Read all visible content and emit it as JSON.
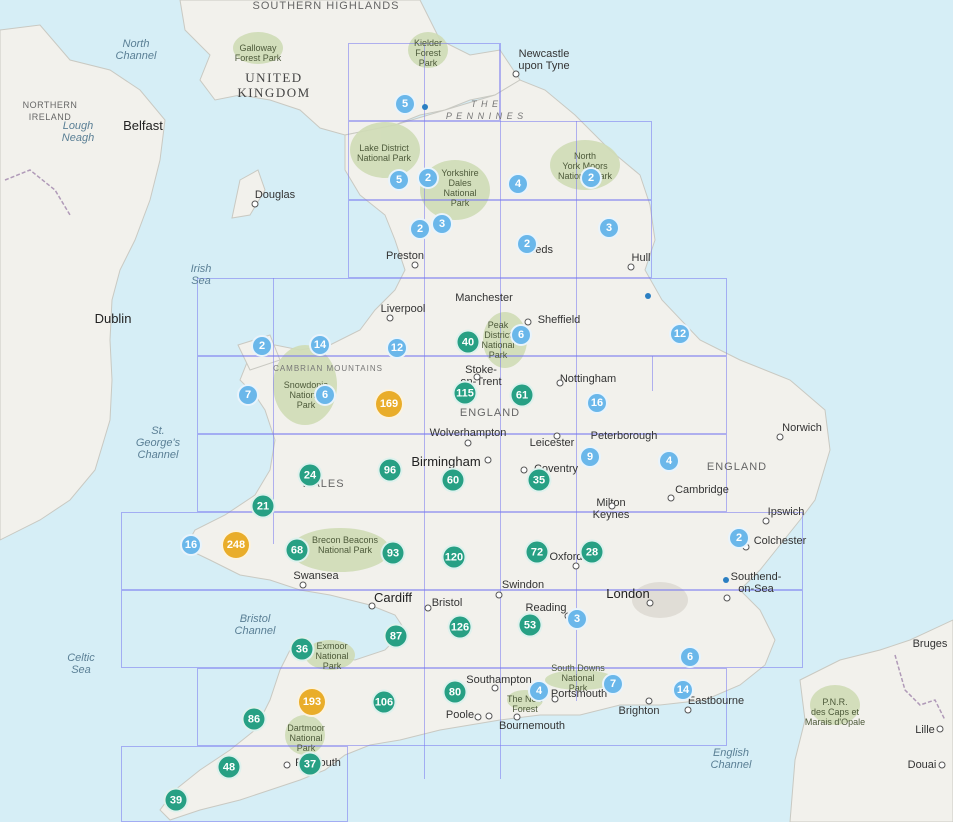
{
  "colors": {
    "water": "#d6eef6",
    "land": "#f2f1ec",
    "parks": "#cfdcb6",
    "grid": "#7878f0",
    "cluster_small": "#6ab7ea",
    "cluster_medium": "#27a084",
    "cluster_large": "#e9ad2a",
    "point": "#2b7fc2"
  },
  "labels": {
    "southern_highlands": "SOUTHERN HIGHLANDS",
    "north_channel": "North\nChannel",
    "galloway": "Galloway\nForest Park",
    "united_kingdom": "UNITED\nKINGDOM",
    "kielder": "Kielder\nForest\nPark",
    "newcastle": "Newcastle\nupon Tyne",
    "northern_ireland": "NORTHERN\nIRELAND",
    "lough_neagh": "Lough\nNeagh",
    "belfast": "Belfast",
    "the_pennines": "T H E\nP E N N I N E S",
    "lake_district": "Lake District\nNational Park",
    "yorkshire_dales": "Yorkshire\nDales\nNational\nPark",
    "north_york_moors": "North\nYork Moors\nNational Park",
    "douglas": "Douglas",
    "leeds": "Leeds",
    "irish_sea": "Irish\nSea",
    "preston": "Preston",
    "hull": "Hull",
    "manchester": "Manchester",
    "dublin": "Dublin",
    "liverpool": "Liverpool",
    "sheffield": "Sheffield",
    "peak_district": "Peak\nDistrict\nNational\nPark",
    "cambrian": "CAMBRIAN MOUNTAINS",
    "stoke": "Stoke-\non-Trent",
    "nottingham": "Nottingham",
    "snowdonia": "Snowdonia\nNational\nPark",
    "england_mid": "ENGLAND",
    "st_georges": "St.\nGeorge's\nChannel",
    "wolverhampton": "Wolverhampton",
    "peterborough": "Peterborough",
    "norwich": "Norwich",
    "leicester": "Leicester",
    "birmingham": "Birmingham",
    "coventry": "Coventry",
    "england_east": "ENGLAND",
    "wales": "WALES",
    "cambridge": "Cambridge",
    "milton_keynes": "Milton\nKeynes",
    "ipswich": "Ipswich",
    "brecon": "Brecon Beacons\nNational Park",
    "oxford": "Oxford",
    "colchester": "Colchester",
    "swansea": "Swansea",
    "southend": "Southend-\non-Sea",
    "swindon": "Swindon",
    "cardiff": "Cardiff",
    "bristol": "Bristol",
    "london": "London",
    "reading": "Reading",
    "bristol_channel": "Bristol\nChannel",
    "celtic_sea": "Celtic\nSea",
    "exmoor": "Exmoor\nNational\nPark",
    "southampton": "Southampton",
    "south_downs": "South Downs\nNational\nPark",
    "portsmouth": "Portsmouth",
    "eastbourne": "Eastbourne",
    "brighton": "Brighton",
    "new_forest": "The New\nForest",
    "bruges": "Bruges",
    "poole": "Poole",
    "bournemouth": "Bournemouth",
    "pnr": "P.N.R.\ndes Caps et\nMarais d'Opale",
    "dartmoor": "Dartmoor\nNational\nPark",
    "lille": "Lille",
    "english_channel": "English\nChannel",
    "plymouth": "Plymouth",
    "douai": "Douai"
  },
  "clusters": [
    {
      "id": "c01",
      "count": "5"
    },
    {
      "id": "c02",
      "count": "5"
    },
    {
      "id": "c03",
      "count": "2"
    },
    {
      "id": "c04",
      "count": "4"
    },
    {
      "id": "c05",
      "count": "2"
    },
    {
      "id": "c06",
      "count": "2"
    },
    {
      "id": "c07",
      "count": "3"
    },
    {
      "id": "c08",
      "count": "3"
    },
    {
      "id": "c09",
      "count": "2"
    },
    {
      "id": "c10",
      "count": "2"
    },
    {
      "id": "c11",
      "count": "14"
    },
    {
      "id": "c12",
      "count": "12"
    },
    {
      "id": "c13",
      "count": "40"
    },
    {
      "id": "c14",
      "count": "6"
    },
    {
      "id": "c15",
      "count": "12"
    },
    {
      "id": "c16",
      "count": "7"
    },
    {
      "id": "c17",
      "count": "6"
    },
    {
      "id": "c18",
      "count": "169"
    },
    {
      "id": "c19",
      "count": "115"
    },
    {
      "id": "c20",
      "count": "61"
    },
    {
      "id": "c21",
      "count": "16"
    },
    {
      "id": "c22",
      "count": "9"
    },
    {
      "id": "c23",
      "count": "4"
    },
    {
      "id": "c24",
      "count": "24"
    },
    {
      "id": "c25",
      "count": "96"
    },
    {
      "id": "c26",
      "count": "60"
    },
    {
      "id": "c27",
      "count": "35"
    },
    {
      "id": "c28",
      "count": "21"
    },
    {
      "id": "c29",
      "count": "16"
    },
    {
      "id": "c30",
      "count": "248"
    },
    {
      "id": "c31",
      "count": "68"
    },
    {
      "id": "c32",
      "count": "93"
    },
    {
      "id": "c33",
      "count": "120"
    },
    {
      "id": "c34",
      "count": "72"
    },
    {
      "id": "c35",
      "count": "28"
    },
    {
      "id": "c36",
      "count": "2"
    },
    {
      "id": "c37",
      "count": "87"
    },
    {
      "id": "c38",
      "count": "126"
    },
    {
      "id": "c39",
      "count": "53"
    },
    {
      "id": "c40",
      "count": "3"
    },
    {
      "id": "c41",
      "count": "36"
    },
    {
      "id": "c42",
      "count": "6"
    },
    {
      "id": "c43",
      "count": "80"
    },
    {
      "id": "c44",
      "count": "4"
    },
    {
      "id": "c45",
      "count": "7"
    },
    {
      "id": "c46",
      "count": "14"
    },
    {
      "id": "c47",
      "count": "86"
    },
    {
      "id": "c48",
      "count": "193"
    },
    {
      "id": "c49",
      "count": "106"
    },
    {
      "id": "c50",
      "count": "48"
    },
    {
      "id": "c51",
      "count": "37"
    },
    {
      "id": "c52",
      "count": "39"
    }
  ]
}
